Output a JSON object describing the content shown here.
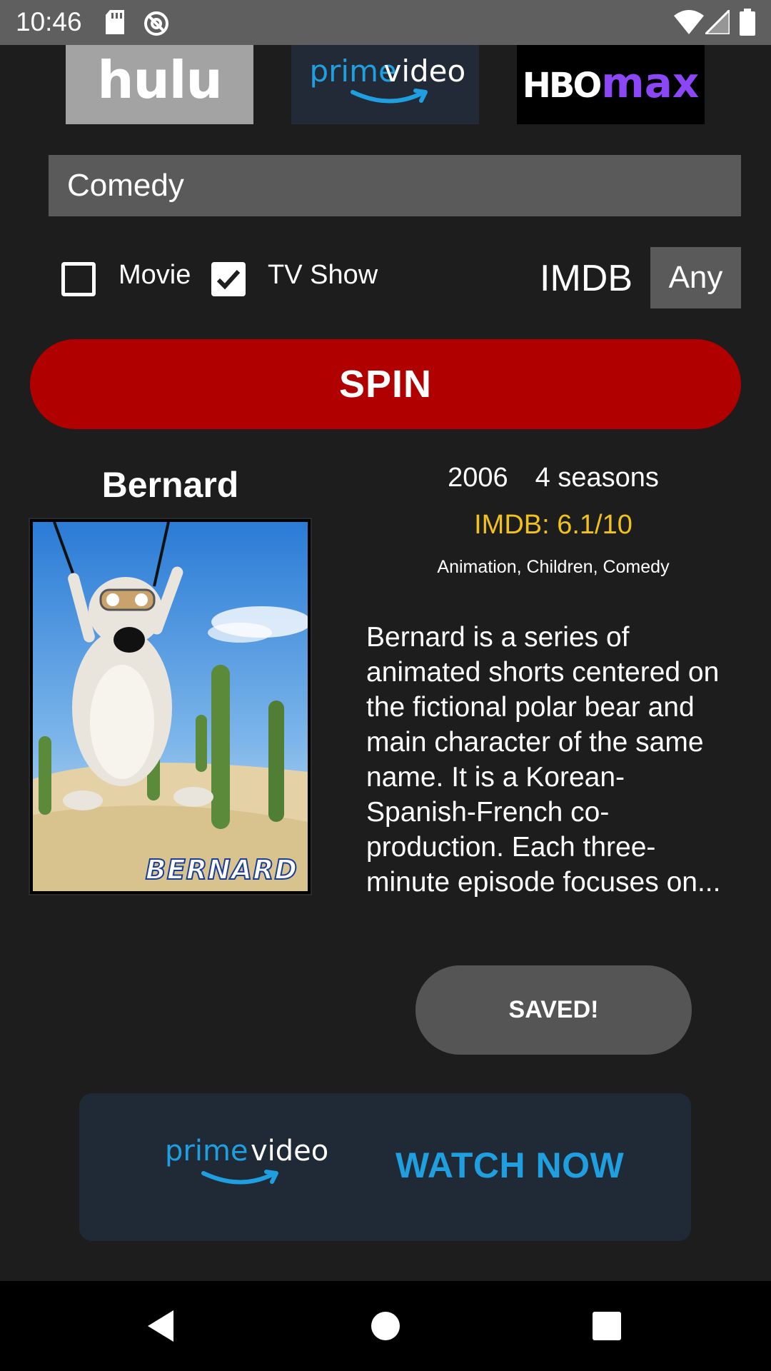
{
  "status_bar": {
    "time": "10:46",
    "icons": [
      "sd-card-icon",
      "no-sync-icon",
      "wifi-icon",
      "signal-icon",
      "battery-icon"
    ]
  },
  "services": {
    "hulu": {
      "name": "hulu",
      "bg": "#a3a3a3"
    },
    "prime": {
      "name_part1": "prime",
      "name_part2": "video",
      "accent": "#1f9fe0",
      "bg": "#212a36"
    },
    "hbo": {
      "name_part1": "HBO",
      "name_part2": "max",
      "accent": "#8b46f5",
      "bg": "#000000"
    }
  },
  "genre": {
    "value": "Comedy"
  },
  "filters": {
    "movie": {
      "label": "Movie",
      "checked": false
    },
    "tv_show": {
      "label": "TV Show",
      "checked": true
    },
    "imdb_label": "IMDB",
    "imdb_value": "Any"
  },
  "spin_button": {
    "label": "SPIN",
    "color": "#b00000"
  },
  "result": {
    "title": "Bernard",
    "year": "2006",
    "seasons": "4 seasons",
    "rating": "IMDB: 6.1/10",
    "rating_color": "#f1c21b",
    "genres": "Animation, Children, Comedy",
    "description": "Bernard is a series of animated shorts centered on the fictional polar bear and main character of the same name. It is a Korean-Spanish-French co-production. Each three-minute episode focuses on...",
    "poster_caption": "BERNARD"
  },
  "saved_button": {
    "label": "SAVED!"
  },
  "watch_now": {
    "service_part1": "prime",
    "service_part2": "video",
    "label": "WATCH NOW",
    "color": "#1f9fe0"
  },
  "nav": {
    "items": [
      "back-icon",
      "home-icon",
      "recents-icon"
    ]
  }
}
